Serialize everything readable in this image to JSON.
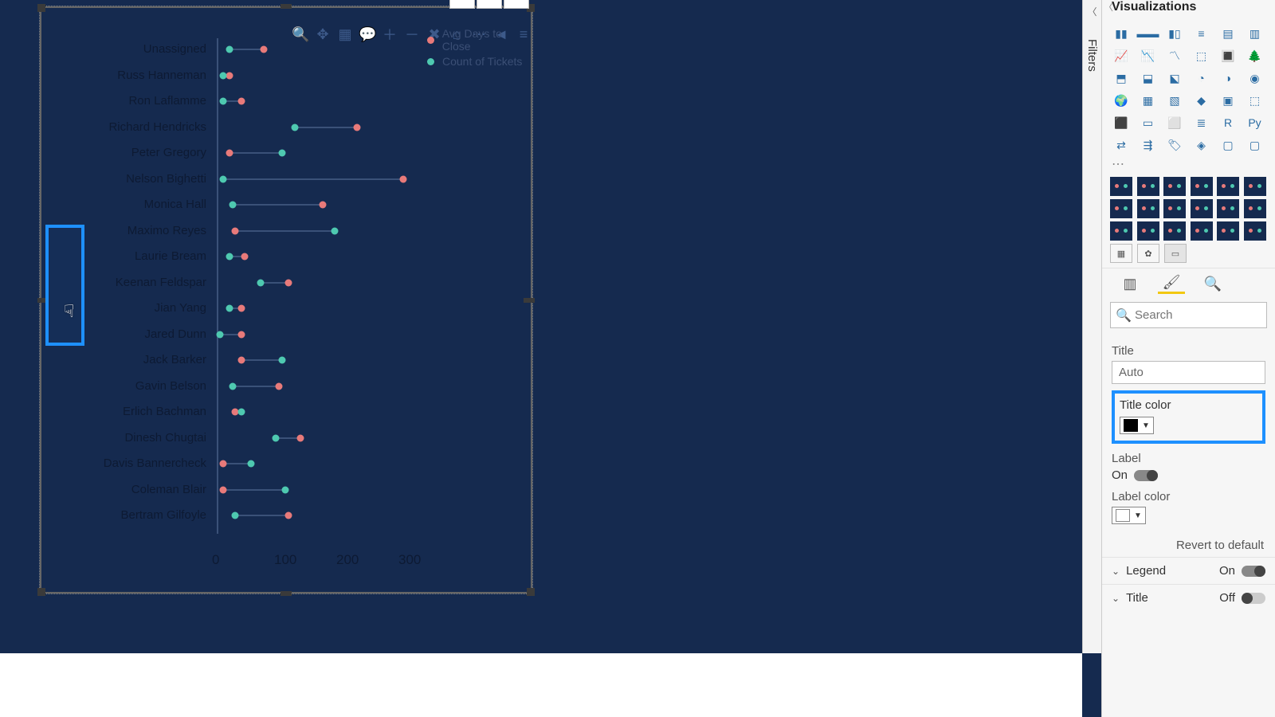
{
  "panes": {
    "filters_label": "Filters",
    "visualizations_title": "Visualizations"
  },
  "search": {
    "placeholder": "Search"
  },
  "format": {
    "title_label": "Title",
    "title_value": "Auto",
    "title_color_label": "Title color",
    "title_color_value": "#000000",
    "label_label": "Label",
    "label_toggle_text": "On",
    "label_on": true,
    "label_color_label": "Label color",
    "label_color_value": "#FFFFFF",
    "revert_text": "Revert to default"
  },
  "sections": {
    "legend": {
      "name": "Legend",
      "state_text": "On",
      "on": true
    },
    "title": {
      "name": "Title",
      "state_text": "Off",
      "on": false
    }
  },
  "legend": {
    "item1": "Avg Days to Close",
    "item2": "Count of Tickets"
  },
  "chart_data": {
    "type": "dumbbell",
    "xlabel": "",
    "ylabel": "",
    "xlim": [
      0,
      320
    ],
    "x_ticks": [
      0,
      100,
      200,
      300
    ],
    "categories": [
      "Unassigned",
      "Russ Hanneman",
      "Ron Laflamme",
      "Richard Hendricks",
      "Peter Gregory",
      "Nelson Bighetti",
      "Monica Hall",
      "Maximo Reyes",
      "Laurie Bream",
      "Keenan Feldspar",
      "Jian Yang",
      "Jared Dunn",
      "Jack Barker",
      "Gavin Belson",
      "Erlich Bachman",
      "Dinesh Chugtai",
      "Davis Bannercheck",
      "Coleman Blair",
      "Bertram Gilfoyle"
    ],
    "series": [
      {
        "name": "Avg Days to Close",
        "color": "#e87a7a",
        "values": [
          75,
          20,
          40,
          225,
          20,
          300,
          170,
          30,
          45,
          115,
          40,
          40,
          40,
          100,
          30,
          135,
          10,
          10,
          115
        ]
      },
      {
        "name": "Count of Tickets",
        "color": "#4ec9b0",
        "values": [
          20,
          10,
          10,
          125,
          105,
          10,
          25,
          190,
          20,
          70,
          20,
          5,
          105,
          25,
          40,
          95,
          55,
          110,
          30
        ]
      }
    ]
  },
  "xticks": {
    "t0": "0",
    "t1": "100",
    "t2": "200",
    "t3": "300"
  },
  "ylabels": {
    "y0": "Unassigned",
    "y1": "Russ Hanneman",
    "y2": "Ron Laflamme",
    "y3": "Richard Hendricks",
    "y4": "Peter Gregory",
    "y5": "Nelson Bighetti",
    "y6": "Monica Hall",
    "y7": "Maximo Reyes",
    "y8": "Laurie Bream",
    "y9": "Keenan Feldspar",
    "y10": "Jian Yang",
    "y11": "Jared Dunn",
    "y12": "Jack Barker",
    "y13": "Gavin Belson",
    "y14": "Erlich Bachman",
    "y15": "Dinesh Chugtai",
    "y16": "Davis Bannercheck",
    "y17": "Coleman Blair",
    "y18": "Bertram Gilfoyle"
  }
}
